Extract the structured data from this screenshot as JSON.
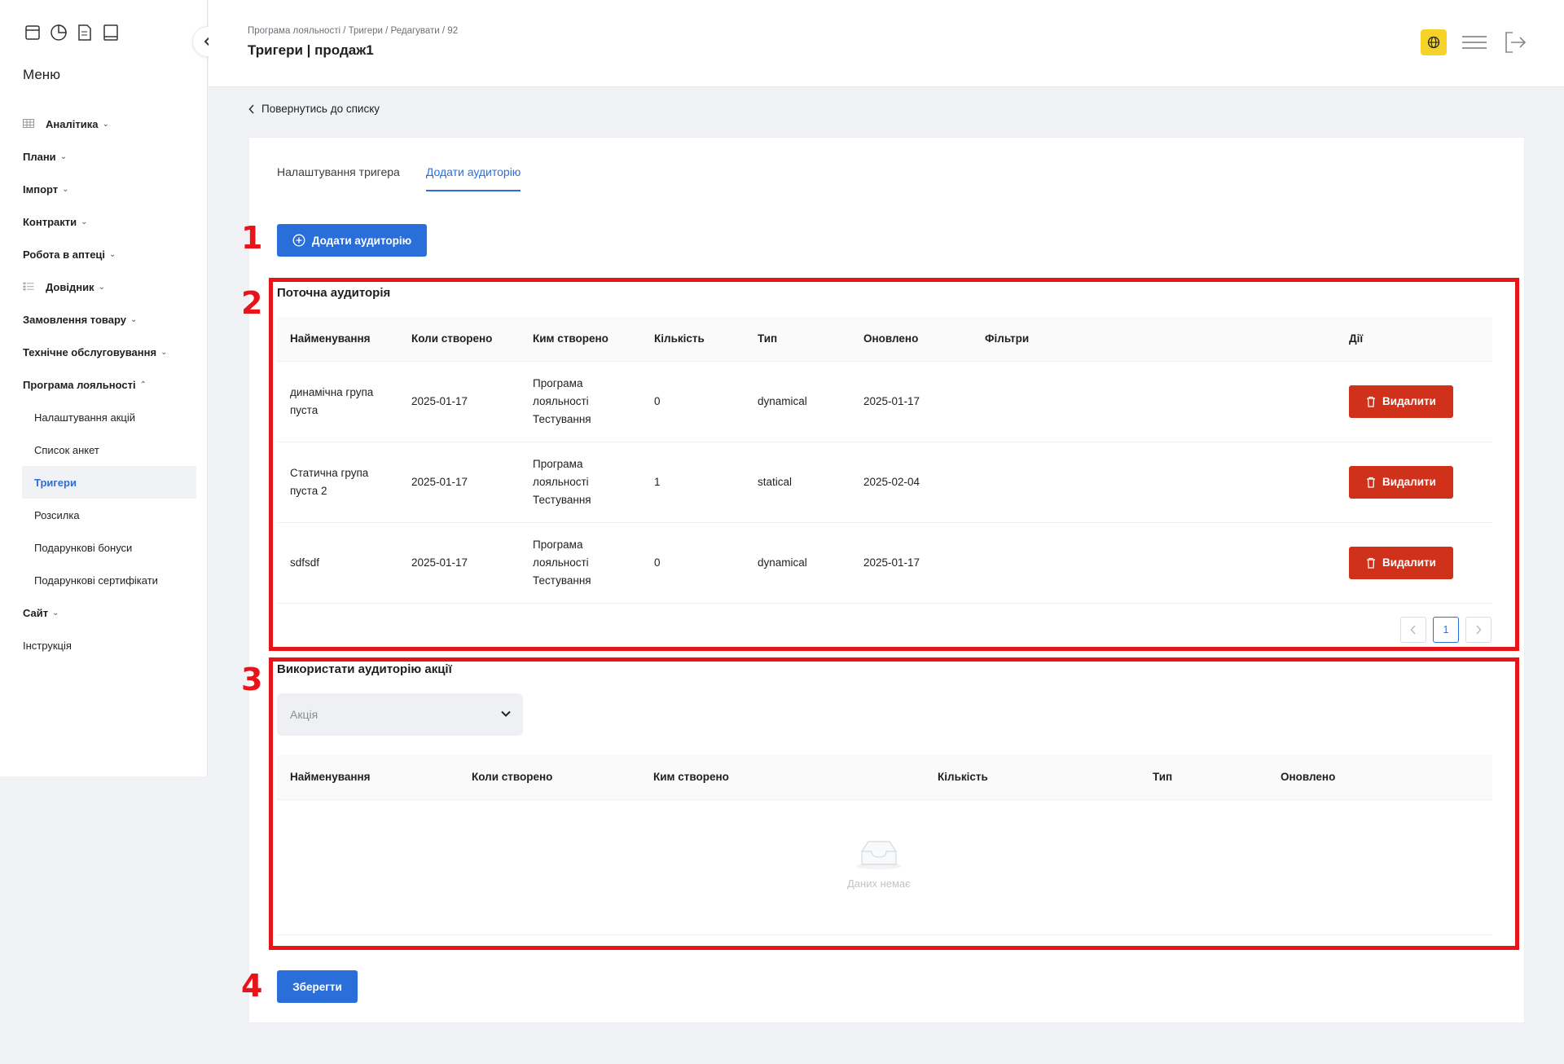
{
  "sidebar": {
    "top_icons": [
      "archive-icon",
      "pie-chart-icon",
      "document-icon",
      "book-icon"
    ],
    "menu_title": "Меню",
    "items": [
      {
        "label": "Аналітика",
        "icon": "table-grid-icon",
        "caret": "⌄"
      },
      {
        "label": "Плани",
        "caret": "⌄"
      },
      {
        "label": "Імпорт",
        "caret": "⌄"
      },
      {
        "label": "Контракти",
        "caret": "⌄"
      },
      {
        "label": "Робота в аптеці",
        "caret": "⌄"
      },
      {
        "label": "Довідник",
        "icon": "list-icon",
        "caret": "⌄"
      },
      {
        "label": "Замовлення товару",
        "caret": "⌄"
      },
      {
        "label": "Технічне обслуговування",
        "caret": "⌄"
      },
      {
        "label": "Програма лояльності",
        "caret": "⌃"
      }
    ],
    "subitems": [
      {
        "label": "Налаштування акцій"
      },
      {
        "label": "Список анкет"
      },
      {
        "label": "Тригери"
      },
      {
        "label": "Розсилка"
      },
      {
        "label": "Подарункові бонуси"
      },
      {
        "label": "Подарункові сертифікати"
      }
    ],
    "site": {
      "label": "Сайт",
      "caret": "⌄"
    },
    "instruction": {
      "label": "Інструкція"
    }
  },
  "header": {
    "breadcrumb": "Програма лояльності / Тригери / Редагувати / 92",
    "title": "Тригери | продаж1",
    "icons": [
      "globe-icon",
      "hamburger-icon",
      "logout-icon"
    ],
    "lang_color": "#f5d328"
  },
  "back_link": "Повернутись до списку",
  "tabs": [
    {
      "label": "Налаштування тригера",
      "active": false
    },
    {
      "label": "Додати аудиторію",
      "active": true
    }
  ],
  "add_audience_button": "Додати аудиторію",
  "markers": [
    "1",
    "2",
    "3",
    "4"
  ],
  "current_audience": {
    "title": "Поточна аудиторія",
    "columns": [
      "Найменування",
      "Коли створено",
      "Ким створено",
      "Кількість",
      "Тип",
      "Оновлено",
      "Фільтри",
      "Дії"
    ],
    "rows": [
      {
        "name": "динамічна група пуста",
        "created": "2025-01-17",
        "created_by": "Програма лояльності Тестування",
        "count": "0",
        "type": "dynamical",
        "updated": "2025-01-17",
        "filters": "",
        "action": "Видалити"
      },
      {
        "name": "Статична група пуста 2",
        "created": "2025-01-17",
        "created_by": "Програма лояльності Тестування",
        "count": "1",
        "type": "statical",
        "updated": "2025-02-04",
        "filters": "",
        "action": "Видалити"
      },
      {
        "name": "sdfsdf",
        "created": "2025-01-17",
        "created_by": "Програма лояльності Тестування",
        "count": "0",
        "type": "dynamical",
        "updated": "2025-01-17",
        "filters": "",
        "action": "Видалити"
      }
    ],
    "pagination": {
      "current": "1"
    }
  },
  "promo_audience": {
    "title": "Використати аудиторію акції",
    "select_placeholder": "Акція",
    "columns": [
      "Найменування",
      "Коли створено",
      "Ким створено",
      "Кількість",
      "Тип",
      "Оновлено"
    ],
    "empty_text": "Даних немає"
  },
  "save_button": "Зберегти",
  "colors": {
    "primary": "#2a6fd9",
    "danger": "#d0311a",
    "highlight": "#e8141a"
  }
}
